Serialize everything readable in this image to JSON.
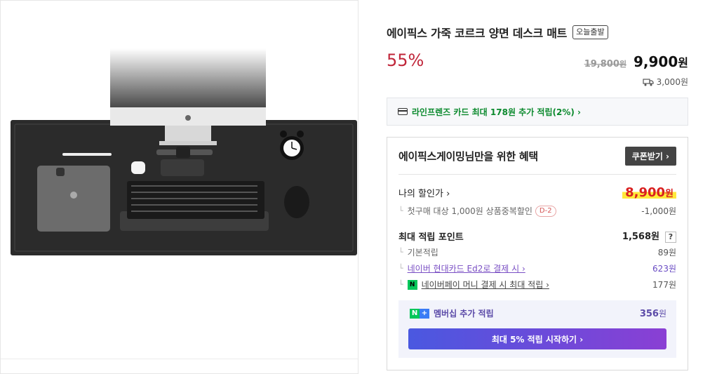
{
  "product": {
    "title": "에이픽스 가죽 코르크 양면 데스크 매트",
    "badge": "오늘출발",
    "discount": "55%",
    "original_price": "19,800",
    "original_won": "원",
    "sale_price": "9,900",
    "sale_won": "원",
    "shipping": "3,000원"
  },
  "card_promo": "라인프렌즈 카드 최대 178원 추가 적립(2%) ›",
  "benefits": {
    "heading": "에이픽스게이밍님만을 위한 혜택",
    "coupon_button": "쿠폰받기 ›",
    "my_price_label": "나의 할인가 ›",
    "my_price": "8,900",
    "my_price_won": "원",
    "first_purchase_label": "첫구매 대상 1,000원 상품중복할인",
    "first_purchase_dday": "D-2",
    "first_purchase_value": "-1,000원",
    "max_points_label": "최대 적립 포인트",
    "max_points_value": "1,568원",
    "help": "?",
    "points": [
      {
        "label": "기본적립",
        "value": "89원"
      },
      {
        "label": "네이버 현대카드 Ed2로 결제 시 ›",
        "value": "623원"
      },
      {
        "label": "네이버페이 머니 결제 시 최대 적립 ›",
        "value": "177원"
      }
    ],
    "membership_label": "멤버십 추가 적립",
    "membership_value": "356",
    "membership_won": "원",
    "membership_button": "최대 5% 적립 시작하기 ›"
  },
  "colors": {
    "discount_red": "#c0263a",
    "green": "#0c8a2e",
    "purple": "#6a4cc4"
  }
}
